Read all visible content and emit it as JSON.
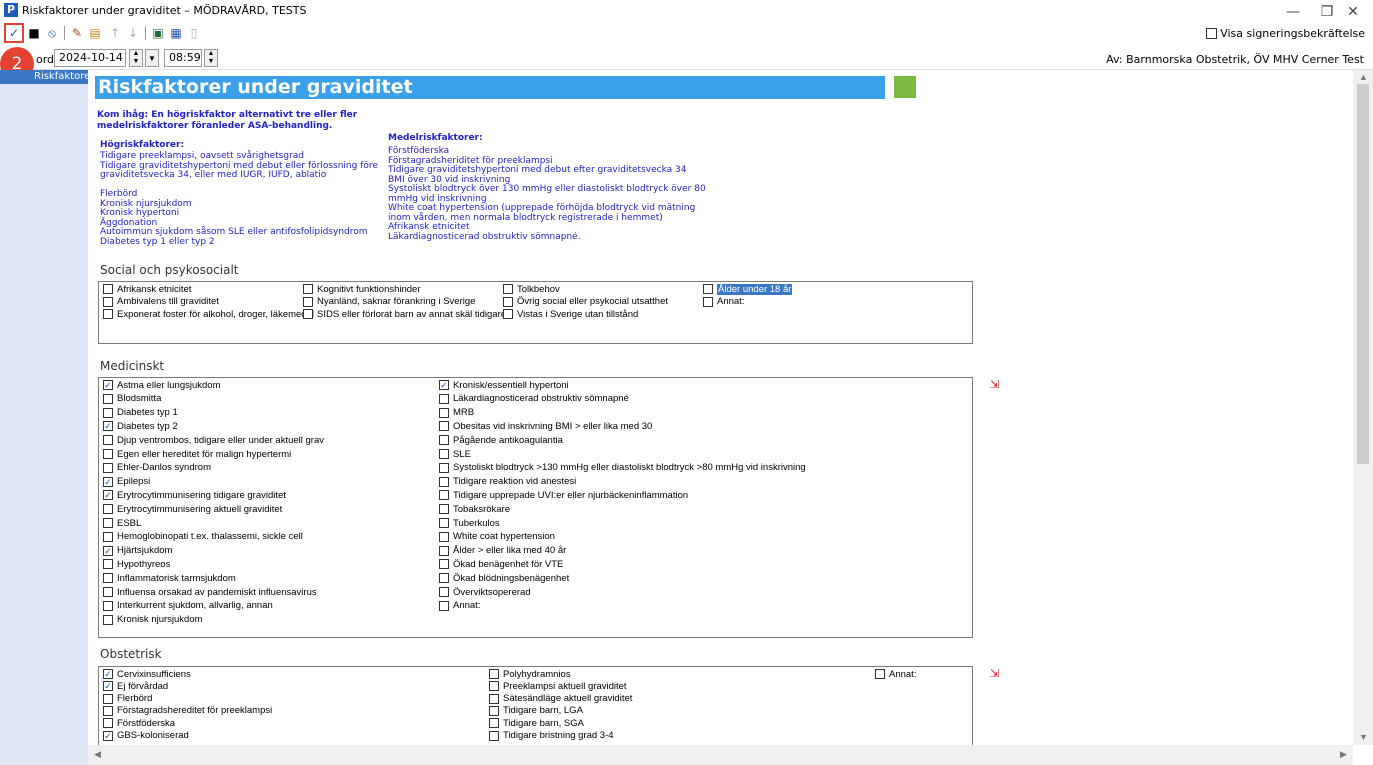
{
  "window": {
    "app_icon": "P",
    "title": "Riskfaktorer under graviditet – MÖDRAVÅRD, TESTS",
    "minimize": "—",
    "restore": "❐",
    "close": "✕"
  },
  "toolbar": {
    "sign_label": "Visa signeringsbekräftelse",
    "icons": [
      "checkmark-icon",
      "save-icon",
      "cancel-icon",
      "edit-icon",
      "attach-icon",
      "arrow-up-icon",
      "arrow-down-icon",
      "view-icon",
      "table-icon",
      "print-icon"
    ]
  },
  "badge": {
    "text": "2"
  },
  "daterow": {
    "label": "ord:",
    "date": "2024-10-14",
    "time": "08:59",
    "author": "Av:  Barnmorska Obstetrik, ÖV MHV Cerner Test"
  },
  "left_panel": {
    "item": "Riskfaktorer under graviditet"
  },
  "form": {
    "title": "Riskfaktorer under graviditet",
    "remember_line1": "Kom ihåg: En högriskfaktor alternativt tre eller fler",
    "remember_line2": "medelriskfaktorer föranleder ASA-behandling.",
    "high_head": "Högriskfaktorer:",
    "high_list": "Tidigare preeklampsi, oavsett svårighetsgrad\nTidigare graviditetshypertoni med debut eller förlossning före\ngraviditetsvecka 34, eller med IUGR, IUFD, ablatio\n\nFlerbörd\nKronisk njursjukdom\nKronisk hypertoni\nÄggdonation\nAutoimmun sjukdom såsom SLE eller antifosfolipidsyndrom\nDiabetes typ 1 eller typ 2",
    "medium_head": "Medelriskfaktorer:",
    "medium_list": "Förstföderska\nFörstagradsheriditet för preeklampsi\nTidigare graviditetshypertoni med debut efter graviditetsvecka 34\nBMI över 30 vid inskrivning\nSystoliskt blodtryck över 130 mmHg eller diastoliskt blodtryck över 80\nmmHg vid inskrivning\nWhite coat hypertension (upprepade förhöjda blodtryck vid mätning\ninom vården, men normala blodtryck registrerade i hemmet)\nAfrikansk etnicitet\nLäkardiagnosticerad obstruktiv sömnapné."
  },
  "social": {
    "title": "Social och psykosocialt",
    "items": [
      {
        "label": "Afrikansk etnicitet",
        "checked": false
      },
      {
        "label": "Ambivalens till graviditet",
        "checked": false
      },
      {
        "label": "Exponerat foster för alkohol, droger, läkemedel",
        "checked": false
      },
      {
        "label": "Kognitivt funktionshinder",
        "checked": false
      },
      {
        "label": "Nyanländ, saknar förankring i Sverige",
        "checked": false
      },
      {
        "label": "SIDS eller förlorat barn av annat skäl tidigare",
        "checked": false
      },
      {
        "label": "Tolkbehov",
        "checked": false
      },
      {
        "label": "Övrig social eller psykocial utsatthet",
        "checked": false
      },
      {
        "label": "Vistas i Sverige utan tillstånd",
        "checked": false
      },
      {
        "label": "Ålder under 18 år",
        "checked": false
      },
      {
        "label": "Annat:",
        "checked": false
      }
    ]
  },
  "medical": {
    "title": "Medicinskt",
    "items": [
      {
        "label": "Astma eller lungsjukdom",
        "checked": true
      },
      {
        "label": "Blodsmitta",
        "checked": false
      },
      {
        "label": "Diabetes typ 1",
        "checked": false
      },
      {
        "label": "Diabetes typ 2",
        "checked": true
      },
      {
        "label": "Djup ventrombos, tidigare eller under aktuell grav",
        "checked": false
      },
      {
        "label": "Egen eller hereditet för malign hypertermi",
        "checked": false
      },
      {
        "label": "Ehler-Danlos syndrom",
        "checked": false
      },
      {
        "label": "Epilepsi",
        "checked": true
      },
      {
        "label": "Erytrocytimmunisering tidigare graviditet",
        "checked": true
      },
      {
        "label": "Erytrocytimmunisering aktuell graviditet",
        "checked": false
      },
      {
        "label": "ESBL",
        "checked": false
      },
      {
        "label": "Hemoglobinopati t.ex. thalassemi, sickle cell",
        "checked": false
      },
      {
        "label": "Hjärtsjukdom",
        "checked": true
      },
      {
        "label": "Hypothyreos",
        "checked": false
      },
      {
        "label": "Inflammatorisk tarmsjukdom",
        "checked": false
      },
      {
        "label": "Influensa orsakad av pandemiskt influensavirus",
        "checked": false
      },
      {
        "label": "Interkurrent sjukdom, allvarlig, annan",
        "checked": false
      },
      {
        "label": "Kronisk njursjukdom",
        "checked": false
      },
      {
        "label": "Kronisk/essentiell hypertoni",
        "checked": true
      },
      {
        "label": "Läkardiagnosticerad obstruktiv sömnapné",
        "checked": false
      },
      {
        "label": "MRB",
        "checked": false
      },
      {
        "label": "Obesitas vid inskrivning BMI > eller lika med 30",
        "checked": false
      },
      {
        "label": "Pågående antikoagulantia",
        "checked": false
      },
      {
        "label": "SLE",
        "checked": false
      },
      {
        "label": "Systoliskt blodtryck >130 mmHg eller diastoliskt blodtryck >80 mmHg vid inskrivning",
        "checked": false
      },
      {
        "label": "Tidigare reaktion vid anestesi",
        "checked": false
      },
      {
        "label": "Tidigare upprepade UVI:er eller njurbäckeninflammation",
        "checked": false
      },
      {
        "label": "Tobaksrökare",
        "checked": false
      },
      {
        "label": "Tuberkulos",
        "checked": false
      },
      {
        "label": "White coat hypertension",
        "checked": false
      },
      {
        "label": "Ålder > eller lika med 40 år",
        "checked": false
      },
      {
        "label": "Ökad benägenhet för VTE",
        "checked": false
      },
      {
        "label": "Ökad blödningsbenägenhet",
        "checked": false
      },
      {
        "label": "Överviktsopererad",
        "checked": false
      },
      {
        "label": "Annat:",
        "checked": false
      }
    ]
  },
  "obstetric": {
    "title": "Obstetrisk",
    "items": [
      {
        "label": "Cervixinsufficiens",
        "checked": true
      },
      {
        "label": "Ej förvårdad",
        "checked": true
      },
      {
        "label": "Flerbörd",
        "checked": false
      },
      {
        "label": "Förstagradshereditet för preeklampsi",
        "checked": false
      },
      {
        "label": "Förstföderska",
        "checked": false
      },
      {
        "label": "GBS-koloniserad",
        "checked": true
      },
      {
        "label": "Polyhydramnios",
        "checked": false
      },
      {
        "label": "Preeklampsi aktuell graviditet",
        "checked": false
      },
      {
        "label": "Sätesändläge aktuell graviditet",
        "checked": false
      },
      {
        "label": "Tidigare barn, LGA",
        "checked": false
      },
      {
        "label": "Tidigare barn, SGA",
        "checked": false
      },
      {
        "label": "Tidigare bristning grad 3-4",
        "checked": false
      },
      {
        "label": "Annat:",
        "checked": false
      }
    ]
  }
}
